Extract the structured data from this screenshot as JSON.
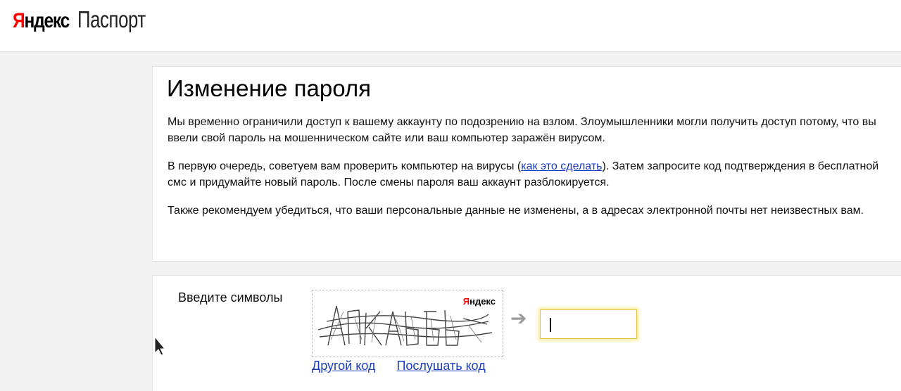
{
  "header": {
    "logo_ya_red": "Я",
    "logo_ya_rest": "ндекс",
    "logo_service": "Паспорт"
  },
  "intro": {
    "title": "Изменение пароля",
    "p1": "Мы временно ограничили доступ к вашему аккаунту по подозрению на взлом. Злоумышленники могли получить доступ потому, что вы ввели свой пароль на мошенническом сайте или ваш компьютер заражён вирусом.",
    "p2_before": "В первую очередь, советуем вам проверить компьютер на вирусы (",
    "p2_link": "как это сделать",
    "p2_after": "). Затем запросите код подтверждения в бесплатной смс и придумайте новый пароль. После смены пароля ваш аккаунт разблокируется.",
    "p3": "Также рекомендуем убедиться, что ваши персональные данные не изменены, а в адресах электронной почты нет неизвестных вам."
  },
  "captcha": {
    "label": "Введите символы",
    "image_logo_red": "Я",
    "image_logo_rest": "ндекс",
    "arrow": "➔",
    "input_value": "",
    "other_code_link": "Другой код",
    "listen_code_link": "Послушать код"
  }
}
